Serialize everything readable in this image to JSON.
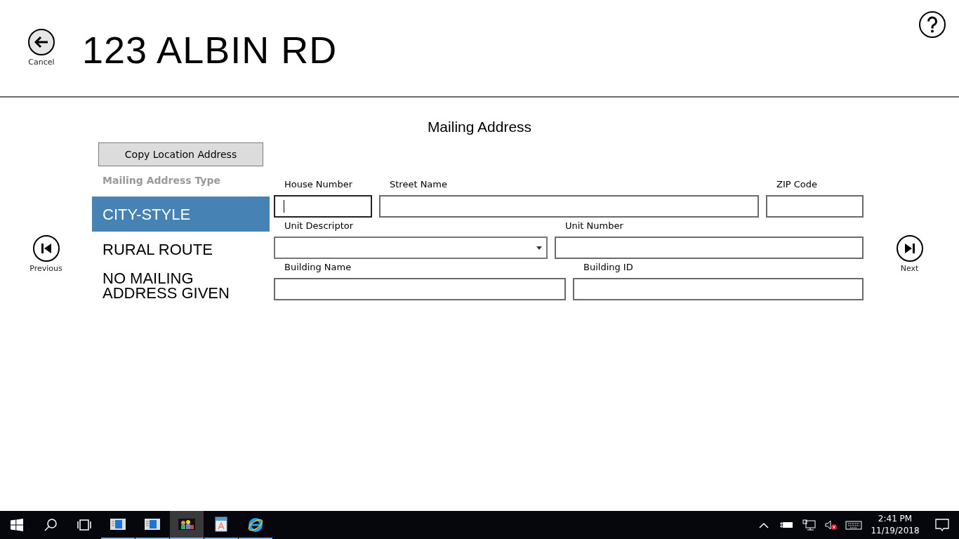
{
  "header": {
    "back_label": "Cancel",
    "title": "123 ALBIN RD"
  },
  "section_title": "Mailing Address",
  "nav": {
    "previous_label": "Previous",
    "next_label": "Next"
  },
  "copy_button": "Copy Location Address",
  "address_type": {
    "label": "Mailing Address Type",
    "options": [
      {
        "label": "CITY-STYLE",
        "selected": true
      },
      {
        "label": "RURAL ROUTE",
        "selected": false
      },
      {
        "label": "NO MAILING ADDRESS GIVEN",
        "selected": false
      }
    ]
  },
  "form_rows": [
    [
      {
        "label": "House Number",
        "kind": "text",
        "focused": true
      },
      {
        "label": "Street Name",
        "kind": "text",
        "focused": false
      },
      {
        "label": "ZIP Code",
        "kind": "text",
        "focused": false
      }
    ],
    [
      {
        "label": "Unit Descriptor",
        "kind": "dropdown",
        "focused": false
      },
      {
        "label": "Unit Number",
        "kind": "text",
        "focused": false
      }
    ],
    [
      {
        "label": "Building Name",
        "kind": "text",
        "focused": false
      },
      {
        "label": "Building ID",
        "kind": "text",
        "focused": false
      }
    ]
  ],
  "taskbar": {
    "apps": [
      {
        "kind": "window",
        "selected": false
      },
      {
        "kind": "window",
        "selected": false
      },
      {
        "kind": "people",
        "selected": true
      },
      {
        "kind": "document",
        "selected": false
      },
      {
        "kind": "browser",
        "selected": false
      }
    ],
    "time": "2:41 PM",
    "date": "11/19/2018"
  }
}
